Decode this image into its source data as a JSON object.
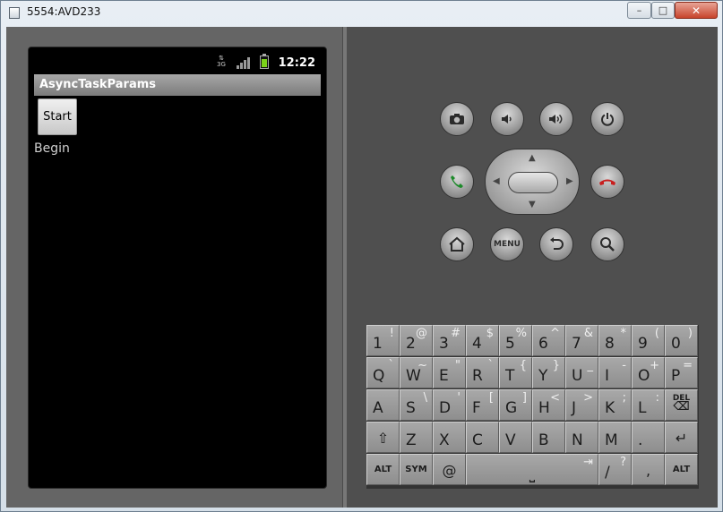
{
  "window": {
    "title": "5554:AVD233",
    "minimize": "–",
    "maximize": "□",
    "close": "✕"
  },
  "device": {
    "status": {
      "time": "12:22",
      "network": "3G"
    },
    "app": {
      "title": "AsyncTaskParams",
      "start_button": "Start",
      "status_text": "Begin"
    }
  },
  "controls": {
    "menu_label": "MENU"
  },
  "keyboard": {
    "rows": [
      [
        {
          "m": "1",
          "s": "!"
        },
        {
          "m": "2",
          "s": "@"
        },
        {
          "m": "3",
          "s": "#"
        },
        {
          "m": "4",
          "s": "$"
        },
        {
          "m": "5",
          "s": "%"
        },
        {
          "m": "6",
          "s": "^"
        },
        {
          "m": "7",
          "s": "&"
        },
        {
          "m": "8",
          "s": "*"
        },
        {
          "m": "9",
          "s": "("
        },
        {
          "m": "0",
          "s": ")"
        }
      ],
      [
        {
          "m": "Q",
          "s": "`"
        },
        {
          "m": "W",
          "s": "~"
        },
        {
          "m": "E",
          "s": "\""
        },
        {
          "m": "R",
          "s": "`"
        },
        {
          "m": "T",
          "s": "{"
        },
        {
          "m": "Y",
          "s": "}"
        },
        {
          "m": "U",
          "s": "_"
        },
        {
          "m": "I",
          "s": "-"
        },
        {
          "m": "O",
          "s": "+"
        },
        {
          "m": "P",
          "s": "="
        }
      ],
      [
        {
          "m": "A",
          "s": ""
        },
        {
          "m": "S",
          "s": "\\"
        },
        {
          "m": "D",
          "s": "'"
        },
        {
          "m": "F",
          "s": "["
        },
        {
          "m": "G",
          "s": "]"
        },
        {
          "m": "H",
          "s": "<"
        },
        {
          "m": "J",
          "s": ">"
        },
        {
          "m": "K",
          "s": ";"
        },
        {
          "m": "L",
          "s": ":"
        }
      ],
      [
        {
          "m": "Z",
          "s": ""
        },
        {
          "m": "X",
          "s": ""
        },
        {
          "m": "C",
          "s": ""
        },
        {
          "m": "V",
          "s": ""
        },
        {
          "m": "B",
          "s": ""
        },
        {
          "m": "N",
          "s": ""
        },
        {
          "m": "M",
          "s": ""
        },
        {
          "m": ".",
          "s": ""
        }
      ]
    ],
    "del_label": "DEL",
    "del_icon": "⌫",
    "shift_icon": "⇧",
    "enter_icon": "↵",
    "alt_label": "ALT",
    "sym_label": "SYM",
    "at_label": "@",
    "space_icon": "⎵",
    "tab_icon": "⇥",
    "slash_key": {
      "m": "/",
      "s": "?"
    },
    "comma_label": ","
  }
}
